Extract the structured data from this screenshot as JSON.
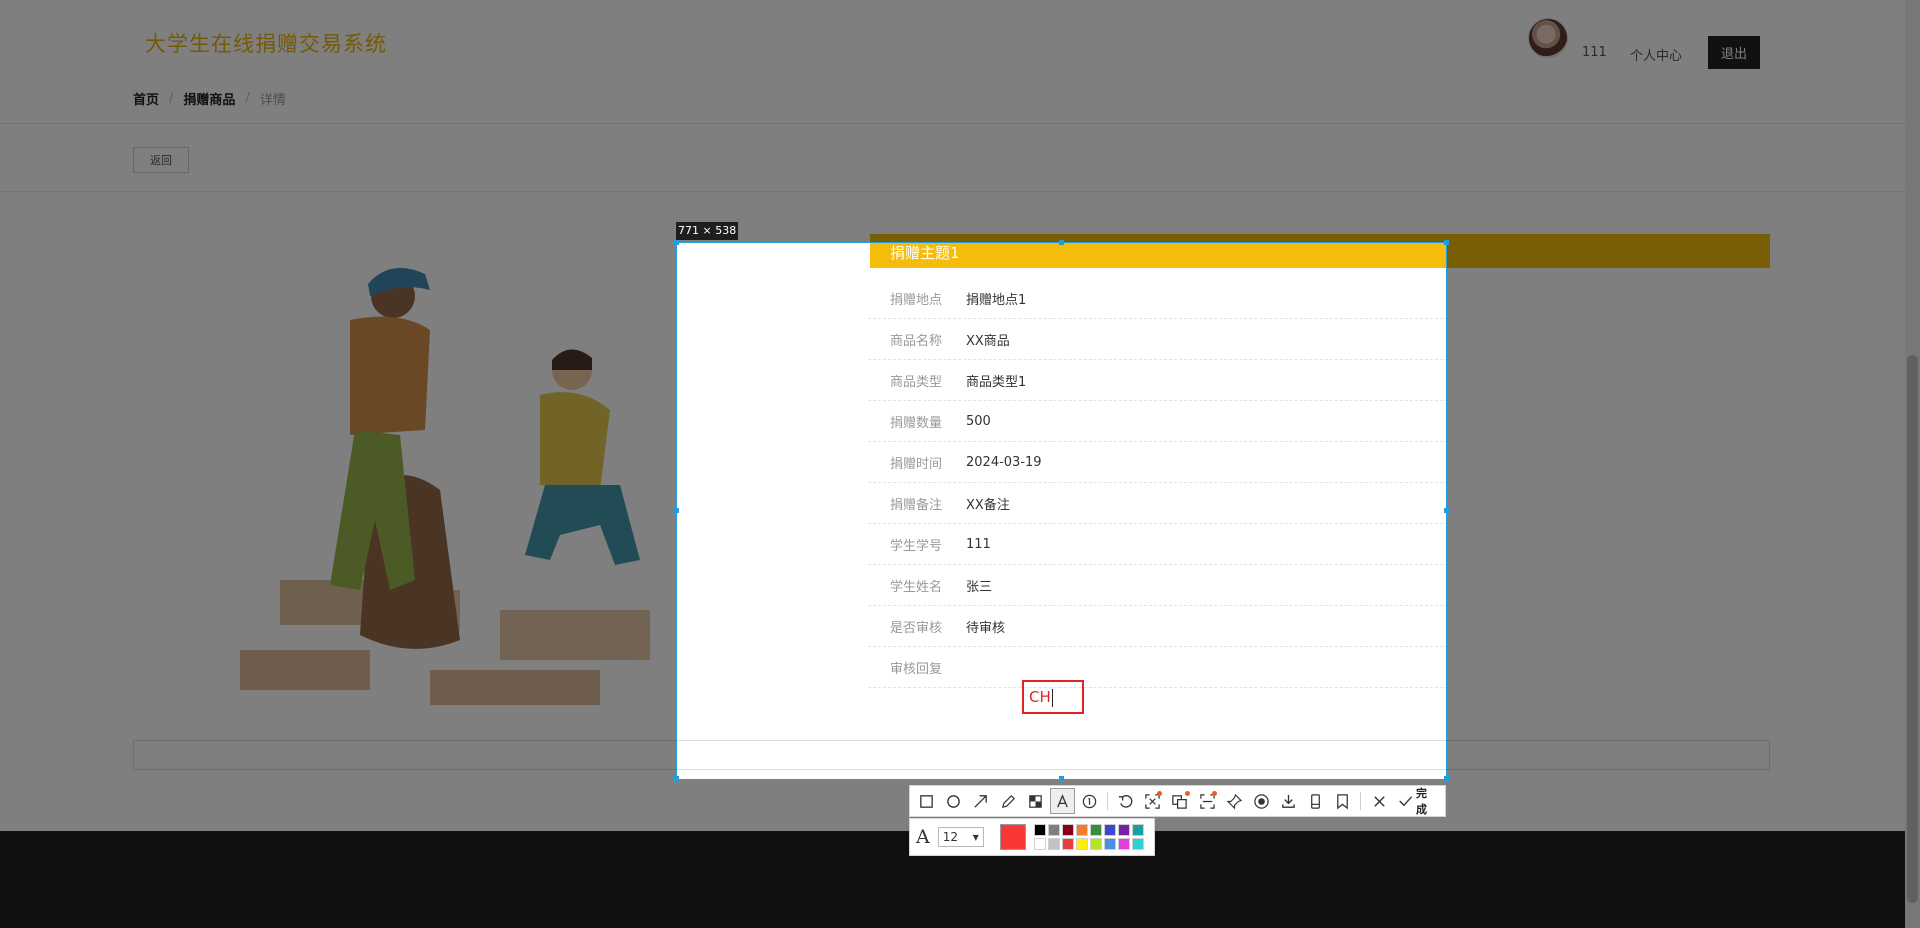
{
  "site": {
    "title": "大学生在线捐赠交易系统"
  },
  "breadcrumb": {
    "home": "首页",
    "goods": "捐赠商品",
    "current": "详情"
  },
  "header": {
    "username": "111",
    "personal_center": "个人中心",
    "logout": "退出"
  },
  "back_button": "返回",
  "detail": {
    "title": "捐赠主题1",
    "rows": [
      {
        "label": "捐赠地点",
        "value": "捐赠地点1"
      },
      {
        "label": "商品名称",
        "value": "XX商品"
      },
      {
        "label": "商品类型",
        "value": "商品类型1"
      },
      {
        "label": "捐赠数量",
        "value": "500"
      },
      {
        "label": "捐赠时间",
        "value": "2024-03-19"
      },
      {
        "label": "捐赠备注",
        "value": "XX备注"
      },
      {
        "label": "学生学号",
        "value": "111"
      },
      {
        "label": "学生姓名",
        "value": "张三"
      },
      {
        "label": "是否审核",
        "value": "待审核"
      },
      {
        "label": "审核回复",
        "value": ""
      }
    ]
  },
  "snip": {
    "size_label": "771 × 538",
    "text_input": "CH",
    "done_label": "完成",
    "font_size": "12",
    "current_color": "#fa3737",
    "palette": [
      "#000000",
      "#7f7f7f",
      "#880015",
      "#f07c2e",
      "#3c8a3c",
      "#3f48cc",
      "#7b1fa2",
      "#17a1a1",
      "#ffffff",
      "#c3c3c3",
      "#ed3b3b",
      "#fff200",
      "#b5e61d",
      "#4a90e2",
      "#e040d8",
      "#2ed1d1"
    ]
  },
  "colors": {
    "accent": "#f5bc0c",
    "selection": "#1f9ddc",
    "footer": "#202020"
  }
}
